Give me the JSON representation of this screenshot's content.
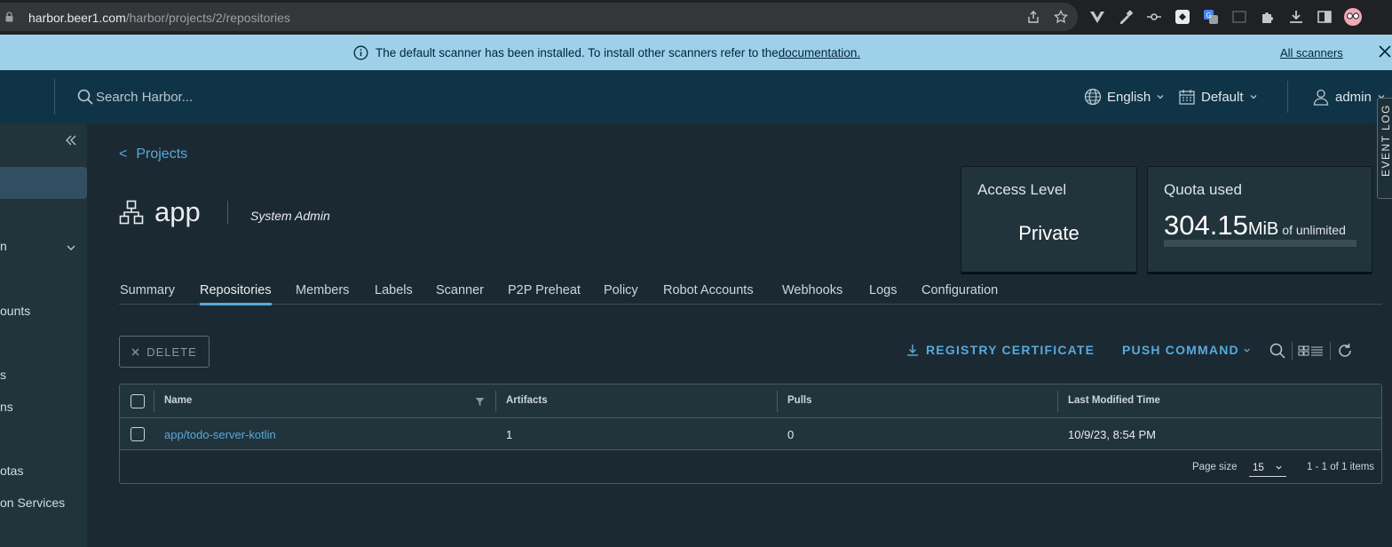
{
  "browser": {
    "url_host": "harbor.beer1.com",
    "url_path": "/harbor/projects/2/repositories"
  },
  "banner": {
    "message": "The default scanner has been installed. To install other scanners refer to the ",
    "link": "documentation.",
    "all_scanners": "All scanners"
  },
  "header": {
    "search_placeholder": "Search Harbor...",
    "language": "English",
    "theme": "Default",
    "user": "admin"
  },
  "sidebar": {
    "items": [
      "n",
      "ounts",
      "s",
      "ns",
      "otas",
      "on Services"
    ]
  },
  "event_log": "EVENT LOG",
  "breadcrumb": {
    "arrow": "<",
    "label": "Projects"
  },
  "project": {
    "name": "app",
    "role": "System Admin"
  },
  "access_card": {
    "title": "Access Level",
    "value": "Private"
  },
  "quota_card": {
    "title": "Quota used",
    "amount": "304.15",
    "unit": "MiB",
    "of": "of unlimited",
    "fill_fraction": 0
  },
  "tabs": [
    "Summary",
    "Repositories",
    "Members",
    "Labels",
    "Scanner",
    "P2P Preheat",
    "Policy",
    "Robot Accounts",
    "Webhooks",
    "Logs",
    "Configuration"
  ],
  "active_tab": "Repositories",
  "toolbar": {
    "delete": "DELETE",
    "registry_certificate": "REGISTRY CERTIFICATE",
    "push_command": "PUSH COMMAND"
  },
  "table": {
    "columns": [
      "Name",
      "Artifacts",
      "Pulls",
      "Last Modified Time"
    ],
    "rows": [
      {
        "name": "app/todo-server-kotlin",
        "artifacts": "1",
        "pulls": "0",
        "modified": "10/9/23, 8:54 PM"
      }
    ],
    "page_size_label": "Page size",
    "page_size": "15",
    "items_count": "1 - 1 of 1 items"
  },
  "colors": {
    "accent": "#57a9de",
    "banner_bg": "#9fd0ea",
    "header_bg": "#0f3448",
    "page_bg": "#1b2a32"
  }
}
